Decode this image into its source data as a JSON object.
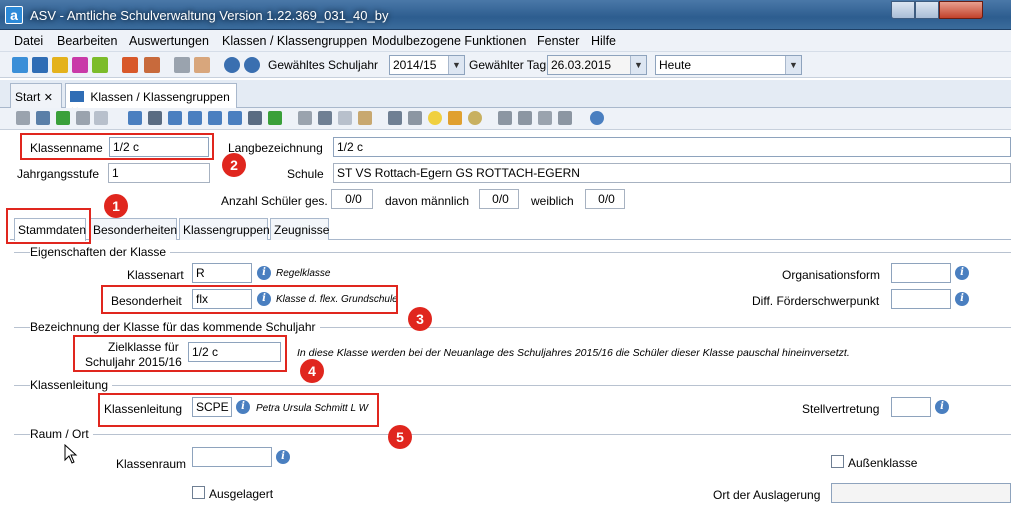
{
  "window": {
    "app_icon": "a",
    "title": "ASV - Amtliche Schulverwaltung Version 1.22.369_031_40_by"
  },
  "menu": [
    "Datei",
    "Bearbeiten",
    "Auswertungen",
    "Klassen / Klassengruppen",
    "Modulbezogene Funktionen",
    "Fenster",
    "Hilfe"
  ],
  "toolbar": {
    "schuljahr_label": "Gewähltes Schuljahr",
    "schuljahr_value": "2014/15",
    "tag_label": "Gewählter Tag",
    "tag_value": "26.03.2015",
    "heute_value": "Heute"
  },
  "tabs": [
    {
      "label": "Start",
      "close": "✕"
    },
    {
      "label": "Klassen / Klassengruppen",
      "close": "✕"
    }
  ],
  "header_form": {
    "klassenname_label": "Klassenname",
    "klassenname_value": "1/2 c",
    "langbezeichnung_label": "Langbezeichnung",
    "langbezeichnung_value": "1/2 c",
    "jahrgangsstufe_label": "Jahrgangsstufe",
    "jahrgangsstufe_value": "1",
    "schule_label": "Schule",
    "schule_value": "ST VS Rottach-Egern GS ROTTACH-EGERN",
    "anzahl_label": "Anzahl Schüler ges.",
    "anzahl_value": "0/0",
    "maennlich_label": "davon männlich",
    "maennlich_value": "0/0",
    "weiblich_label": "weiblich",
    "weiblich_value": "0/0"
  },
  "subtabs": [
    "Stammdaten",
    "Besonderheiten",
    "Klassengruppen",
    "Zeugnisse"
  ],
  "eigenschaften": {
    "title": "Eigenschaften der Klasse",
    "klassenart_label": "Klassenart",
    "klassenart_value": "R",
    "klassenart_desc": "Regelklasse",
    "besonderheit_label": "Besonderheit",
    "besonderheit_value": "flx",
    "besonderheit_desc": "Klasse d. flex. Grundschule",
    "orgform_label": "Organisationsform",
    "orgform_value": "",
    "foerder_label": "Diff. Förderschwerpunkt",
    "foerder_value": ""
  },
  "bezeichnung": {
    "title": "Bezeichnung der Klasse für das kommende Schuljahr",
    "zielklasse_label_1": "Zielklasse für",
    "zielklasse_label_2": "Schuljahr 2015/16",
    "zielklasse_value": "1/2 c",
    "hint": "In diese Klasse werden bei der Neuanlage des Schuljahres 2015/16 die Schüler dieser Klasse pauschal hineinversetzt."
  },
  "klassenleitung": {
    "title": "Klassenleitung",
    "label": "Klassenleitung",
    "value": "SCPE",
    "desc": "Petra Ursula Schmitt L W",
    "stellvertretung_label": "Stellvertretung",
    "stellvertretung_value": ""
  },
  "raum": {
    "title": "Raum / Ort",
    "klassenraum_label": "Klassenraum",
    "klassenraum_value": "",
    "aussenklasse_label": "Außenklasse",
    "ausgelagert_label": "Ausgelagert",
    "ort_label": "Ort der Auslagerung",
    "ort_value": ""
  },
  "annotations": [
    "1",
    "2",
    "3",
    "4",
    "5"
  ],
  "colors": {
    "accent": "#e0261e",
    "titlebar": "#2d5d8f",
    "info": "#4a7fc0"
  }
}
